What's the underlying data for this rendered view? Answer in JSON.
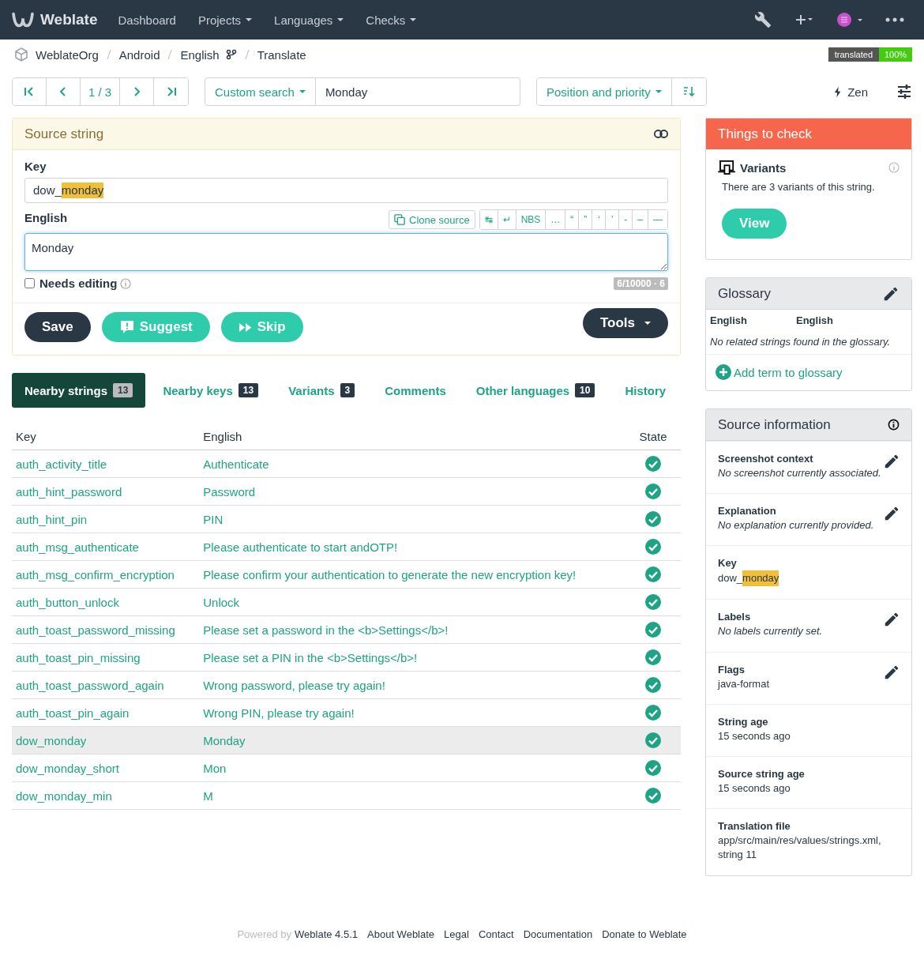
{
  "navbar": {
    "brand": "Weblate",
    "items": [
      {
        "label": "Dashboard",
        "dropdown": false
      },
      {
        "label": "Projects",
        "dropdown": true
      },
      {
        "label": "Languages",
        "dropdown": true
      },
      {
        "label": "Checks",
        "dropdown": true
      }
    ]
  },
  "breadcrumbs": [
    "WeblateOrg",
    "Android",
    "English",
    "Translate"
  ],
  "progress": {
    "label": "translated",
    "value": "100%",
    "level": 1
  },
  "pager": {
    "position": "1 / 3"
  },
  "search": {
    "filter": "Custom search",
    "value": "Monday"
  },
  "sort": {
    "label": "Position and priority"
  },
  "zen": {
    "label": "Zen"
  },
  "source_panel": {
    "title": "Source string",
    "key_label": "Key",
    "key": {
      "text": "dow_",
      "highlight": "monday"
    },
    "lang_label": "English",
    "clone_label": "Clone source",
    "specials": [
      "↹",
      "↵",
      "NBS",
      "…",
      "“",
      "”",
      "‘",
      "’",
      "-",
      "–",
      "—"
    ],
    "value": "Monday",
    "needs_editing": {
      "label": "Needs editing",
      "checked": false
    },
    "counter": "6/10000 · 6"
  },
  "actions": {
    "save": "Save",
    "suggest": "Suggest",
    "skip": "Skip",
    "tools": "Tools"
  },
  "tabs": [
    {
      "label": "Nearby strings",
      "count": "13",
      "selected": true
    },
    {
      "label": "Nearby keys",
      "count": "13",
      "selected": false
    },
    {
      "label": "Variants",
      "count": "3",
      "selected": false
    },
    {
      "label": "Comments",
      "selected": false
    },
    {
      "label": "Other languages",
      "count": "10",
      "selected": false
    },
    {
      "label": "History",
      "selected": false
    }
  ],
  "table": {
    "columns": [
      "Key",
      "English",
      "State"
    ],
    "rows": [
      {
        "key": "auth_activity_title",
        "english": "Authenticate",
        "translated": true,
        "selected": false
      },
      {
        "key": "auth_hint_password",
        "english": "Password",
        "translated": true,
        "selected": false
      },
      {
        "key": "auth_hint_pin",
        "english": "PIN",
        "translated": true,
        "selected": false
      },
      {
        "key": "auth_msg_authenticate",
        "english": "Please authenticate to start andOTP!",
        "translated": true,
        "selected": false
      },
      {
        "key": "auth_msg_confirm_encryption",
        "english": "Please confirm your authentication to generate the new encryption key!",
        "translated": true,
        "selected": false
      },
      {
        "key": "auth_button_unlock",
        "english": "Unlock",
        "translated": true,
        "selected": false
      },
      {
        "key": "auth_toast_password_missing",
        "english": "Please set a password in the <b>Settings</b>!",
        "translated": true,
        "selected": false
      },
      {
        "key": "auth_toast_pin_missing",
        "english": "Please set a PIN in the <b>Settings</b>!",
        "translated": true,
        "selected": false
      },
      {
        "key": "auth_toast_password_again",
        "english": "Wrong password, please try again!",
        "translated": true,
        "selected": false
      },
      {
        "key": "auth_toast_pin_again",
        "english": "Wrong PIN, please try again!",
        "translated": true,
        "selected": false
      },
      {
        "key": "dow_monday",
        "english": "Monday",
        "translated": true,
        "selected": true
      },
      {
        "key": "dow_monday_short",
        "english": "Mon",
        "translated": true,
        "selected": false
      },
      {
        "key": "dow_monday_min",
        "english": "M",
        "translated": true,
        "selected": false
      }
    ]
  },
  "checks": {
    "title": "Things to check",
    "items": [
      {
        "name": "Variants",
        "description": "There are 3 variants of this string.",
        "button": "View"
      }
    ]
  },
  "glossary": {
    "title": "Glossary",
    "columns": [
      "English",
      "English"
    ],
    "empty": "No related strings found in the glossary.",
    "add": "Add term to glossary"
  },
  "source_info": {
    "title": "Source information",
    "items": [
      {
        "label": "Screenshot context",
        "kind": "note",
        "value": "No screenshot currently associated.",
        "editable": true
      },
      {
        "label": "Explanation",
        "kind": "note",
        "value": "No explanation currently provided.",
        "editable": true
      },
      {
        "label": "Key",
        "kind": "key",
        "value": "dow_",
        "highlight": "monday",
        "editable": false
      },
      {
        "label": "Labels",
        "kind": "note",
        "value": "No labels currently set.",
        "editable": true
      },
      {
        "label": "Flags",
        "kind": "text",
        "value": "java-format",
        "editable": true
      },
      {
        "label": "String age",
        "kind": "text",
        "value": "15 seconds ago",
        "editable": false
      },
      {
        "label": "Source string age",
        "kind": "text",
        "value": "15 seconds ago",
        "editable": false
      },
      {
        "label": "Translation file",
        "kind": "text",
        "value": "app/src/main/res/values/strings.xml, string 11",
        "editable": false
      }
    ]
  },
  "footer": {
    "powered": "Powered by",
    "links": [
      "Weblate 4.5.1",
      "About Weblate",
      "Legal",
      "Contact",
      "Documentation",
      "Donate to Weblate"
    ]
  }
}
